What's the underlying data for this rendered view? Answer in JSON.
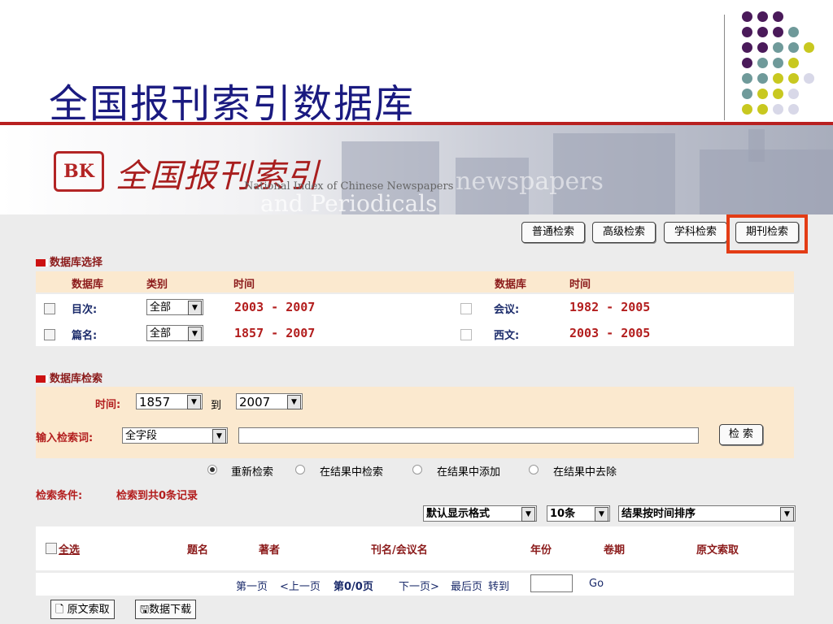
{
  "slide": {
    "title": "全国报刊索引数据库"
  },
  "banner": {
    "logo_text": "全国报刊索引",
    "logo_mark": "BK",
    "english_1": "National Index of Chinese Newspapers",
    "english_2": "and Periodicals",
    "english_3": "newspapers"
  },
  "tabs": [
    "普通检索",
    "高级检索",
    "学科检索",
    "期刊检索"
  ],
  "db_select": {
    "section_title": "数据库选择",
    "headers": [
      "数据库",
      "类别",
      "时间",
      "数据库",
      "时间"
    ],
    "rows": [
      {
        "name": "目次:",
        "category": "全部",
        "time": "2003 - 2007",
        "name2": "会议:",
        "time2": "1982 - 2005"
      },
      {
        "name": "篇名:",
        "category": "全部",
        "time": "1857 - 2007",
        "name2": "西文:",
        "time2": "2003 - 2005"
      }
    ]
  },
  "db_search": {
    "section_title": "数据库检索",
    "time_label": "时间:",
    "from": "1857",
    "to_label": "到",
    "to": "2007",
    "keyword_label": "输入检索词:",
    "field": "全字段",
    "search_button": "检 索",
    "options": [
      "重新检索",
      "在结果中检索",
      "在结果中添加",
      "在结果中去除"
    ]
  },
  "result": {
    "condition_label": "检索条件:",
    "count_text": "检索到共0条记录",
    "format": "默认显示格式",
    "per_page": "10条",
    "sort": "结果按时间排序",
    "columns": [
      "全选",
      "题名",
      "著者",
      "刊名/会议名",
      "年份",
      "卷期",
      "原文索取"
    ],
    "pager": {
      "first": "第一页",
      "prev": "<上一页",
      "page": "第0/0页",
      "next": "下一页>",
      "last": "最后页",
      "goto": "转到",
      "go": "Go"
    },
    "bottom_buttons": [
      "原文索取",
      "数据下载"
    ]
  },
  "colors": {
    "highlight": "#e33c15",
    "accent_red": "#b31e1e",
    "title_blue": "#1a1a80",
    "dot_purple": "#4a1a5a",
    "dot_teal": "#6f9a9a",
    "dot_yellow": "#c8c820",
    "dot_lavender": "#d8d8e8"
  }
}
